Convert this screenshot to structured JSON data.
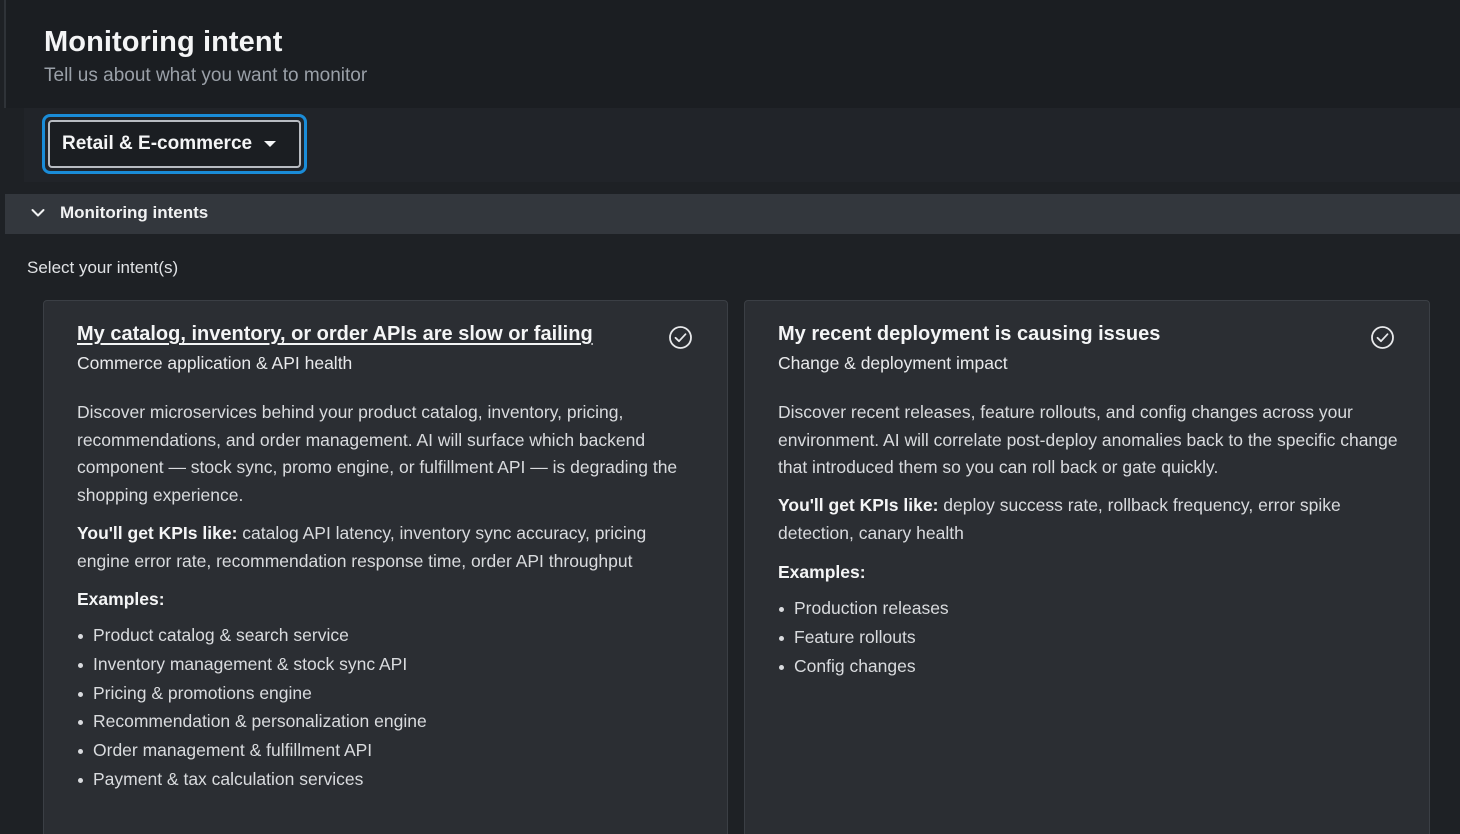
{
  "header": {
    "title": "Monitoring intent",
    "subtitle": "Tell us about what you want to monitor"
  },
  "industry_dropdown": {
    "selected": "Retail & E-commerce",
    "icon": "caret-down-icon"
  },
  "section": {
    "label": "Monitoring intents",
    "expanded": true,
    "prompt": "Select your intent(s)"
  },
  "cards": [
    {
      "title": "My catalog, inventory, or order APIs are slow or failing",
      "subtitle": "Commerce application & API health",
      "description": "Discover microservices behind your product catalog, inventory, pricing, recommendations, and order management. AI will surface which backend component — stock sync, promo engine, or fulfillment API — is degrading the shopping experience.",
      "kpis_label": "You'll get KPIs like:",
      "kpis_text": " catalog API latency, inventory sync accuracy, pricing engine error rate, recommendation response time, order API throughput",
      "examples_label": "Examples:",
      "examples": [
        "Product catalog & search service",
        "Inventory management & stock sync API",
        "Pricing & promotions engine",
        "Recommendation & personalization engine",
        "Order management & fulfillment API",
        "Payment & tax calculation services"
      ],
      "icon": "check-circle-icon"
    },
    {
      "title": "My recent deployment is causing issues",
      "subtitle": "Change & deployment impact",
      "description": "Discover recent releases, feature rollouts, and config changes across your environment. AI will correlate post-deploy anomalies back to the specific change that introduced them so you can roll back or gate quickly.",
      "kpis_label": "You'll get KPIs like:",
      "kpis_text": " deploy success rate, rollback frequency, error spike detection, canary health",
      "examples_label": "Examples:",
      "examples": [
        "Production releases",
        "Feature rollouts",
        "Config changes"
      ],
      "icon": "check-circle-icon"
    }
  ],
  "colors": {
    "background": "#1e2125",
    "card": "#2b2e33",
    "section_bar": "#33373d",
    "focus_ring": "#1a8cd8"
  }
}
